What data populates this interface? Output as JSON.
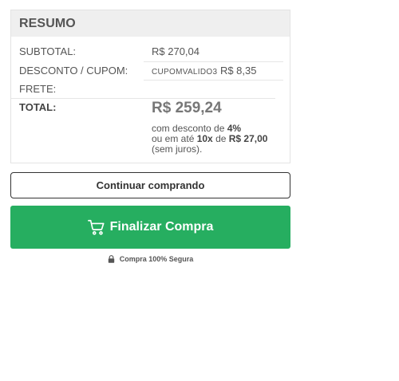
{
  "summary": {
    "title": "RESUMO",
    "subtotal_label": "SUBTOTAL:",
    "subtotal_value": "R$ 270,04",
    "discount_label": "DESCONTO / CUPOM:",
    "coupon_code": "CUPOMVALIDO3",
    "discount_value": "R$ 8,35",
    "shipping_label": "FRETE:",
    "shipping_value": "",
    "total_label": "TOTAL:",
    "total_value": "R$ 259,24",
    "installments": {
      "line1_prefix": "com desconto de ",
      "discount_percent": "4%",
      "line2_prefix": "ou em até ",
      "installment_count": "10x",
      "line2_middle": " de ",
      "installment_value": "R$ 27,00",
      "line3": "(sem juros)."
    }
  },
  "actions": {
    "continue_label": "Continuar comprando",
    "finalize_label": "Finalizar Compra",
    "finalize_icon": "cart-icon",
    "secure_icon": "lock-icon",
    "secure_label": "Compra 100% Segura"
  },
  "colors": {
    "finalize_bg": "#26ae60",
    "header_bg": "#efefef"
  }
}
